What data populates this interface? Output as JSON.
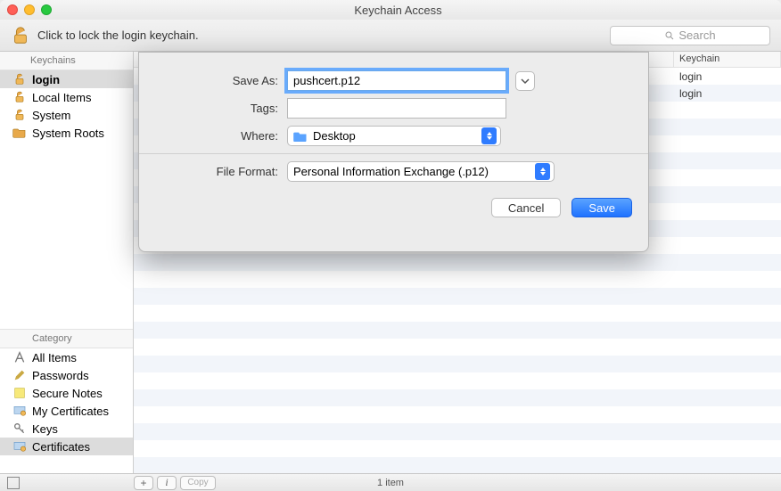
{
  "window": {
    "title": "Keychain Access"
  },
  "toolbar": {
    "lock_hint": "Click to lock the login keychain.",
    "search_placeholder": "Search"
  },
  "sidebar": {
    "keychains_header": "Keychains",
    "keychains": [
      {
        "label": "login",
        "selected": true,
        "bold": true,
        "icon": "lock-open"
      },
      {
        "label": "Local Items",
        "icon": "lock-open"
      },
      {
        "label": "System",
        "icon": "lock-open"
      },
      {
        "label": "System Roots",
        "icon": "folder"
      }
    ],
    "category_header": "Category",
    "categories": [
      {
        "label": "All Items",
        "icon": "aframe"
      },
      {
        "label": "Passwords",
        "icon": "key-pencil"
      },
      {
        "label": "Secure Notes",
        "icon": "note"
      },
      {
        "label": "My Certificates",
        "icon": "cert"
      },
      {
        "label": "Keys",
        "icon": "key"
      },
      {
        "label": "Certificates",
        "icon": "cert",
        "selected": true
      }
    ]
  },
  "table": {
    "headers": {
      "keychain": "Keychain"
    },
    "rows": [
      {
        "keychain": "login"
      },
      {
        "keychain": "login"
      }
    ]
  },
  "dialog": {
    "save_as_label": "Save As:",
    "save_as_value": "pushcert.p12",
    "tags_label": "Tags:",
    "tags_value": "",
    "where_label": "Where:",
    "where_value": "Desktop",
    "file_format_label": "File Format:",
    "file_format_value": "Personal Information Exchange (.p12)",
    "cancel": "Cancel",
    "save": "Save"
  },
  "status": {
    "items": "1 item",
    "copy": "Copy"
  }
}
